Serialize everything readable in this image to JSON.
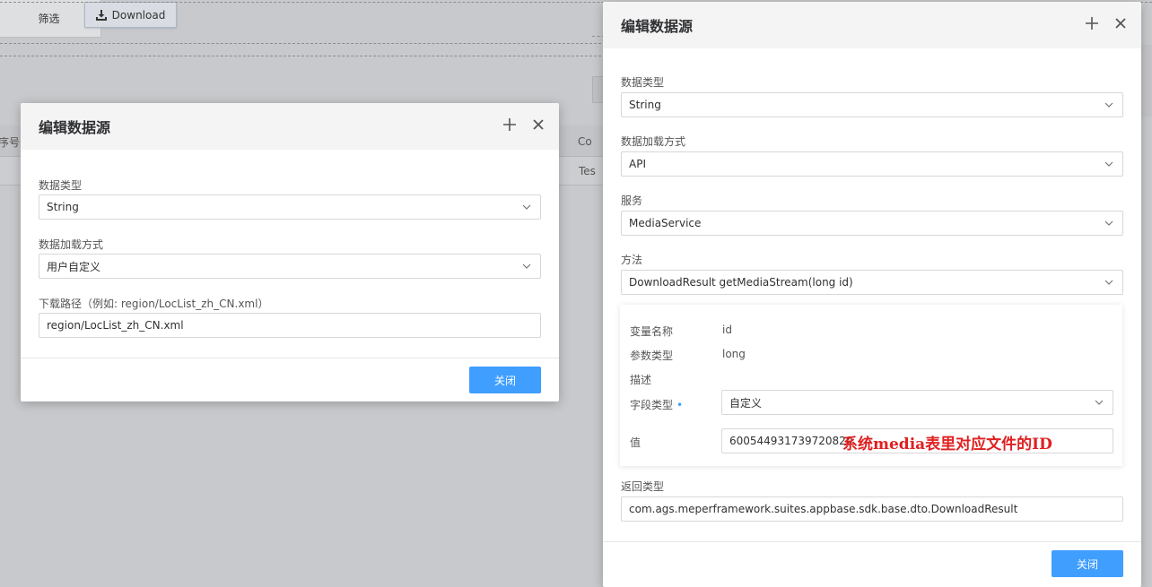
{
  "background": {
    "filter_label": "筛选",
    "download_label": "Download",
    "col_left": "序号",
    "col_right": "Co",
    "row_right": "Tes"
  },
  "dialog_left": {
    "title": "编辑数据源",
    "data_type_label": "数据类型",
    "data_type_value": "String",
    "load_mode_label": "数据加载方式",
    "load_mode_value": "用户自定义",
    "path_label": "下载路径（例如: region/LocList_zh_CN.xml）",
    "path_value": "region/LocList_zh_CN.xml",
    "close_label": "关闭"
  },
  "dialog_right": {
    "title": "编辑数据源",
    "data_type_label": "数据类型",
    "data_type_value": "String",
    "load_mode_label": "数据加载方式",
    "load_mode_value": "API",
    "service_label": "服务",
    "service_value": "MediaService",
    "method_label": "方法",
    "method_value": "DownloadResult getMediaStream(long id)",
    "params": {
      "var_name_label": "变量名称",
      "var_name_value": "id",
      "param_type_label": "参数类型",
      "param_type_value": "long",
      "desc_label": "描述",
      "field_type_label": "字段类型",
      "field_type_required": "•",
      "field_type_value": "自定义",
      "value_label": "值",
      "value_value": "600544931739720820"
    },
    "annotation": "系统media表里对应文件的ID",
    "return_label": "返回类型",
    "return_value": "com.ags.meperframework.suites.appbase.sdk.base.dto.DownloadResult",
    "close_label": "关闭"
  },
  "colors": {
    "primary": "#409eff",
    "annotation": "#e02020",
    "overlay": "#c8c9cc"
  }
}
